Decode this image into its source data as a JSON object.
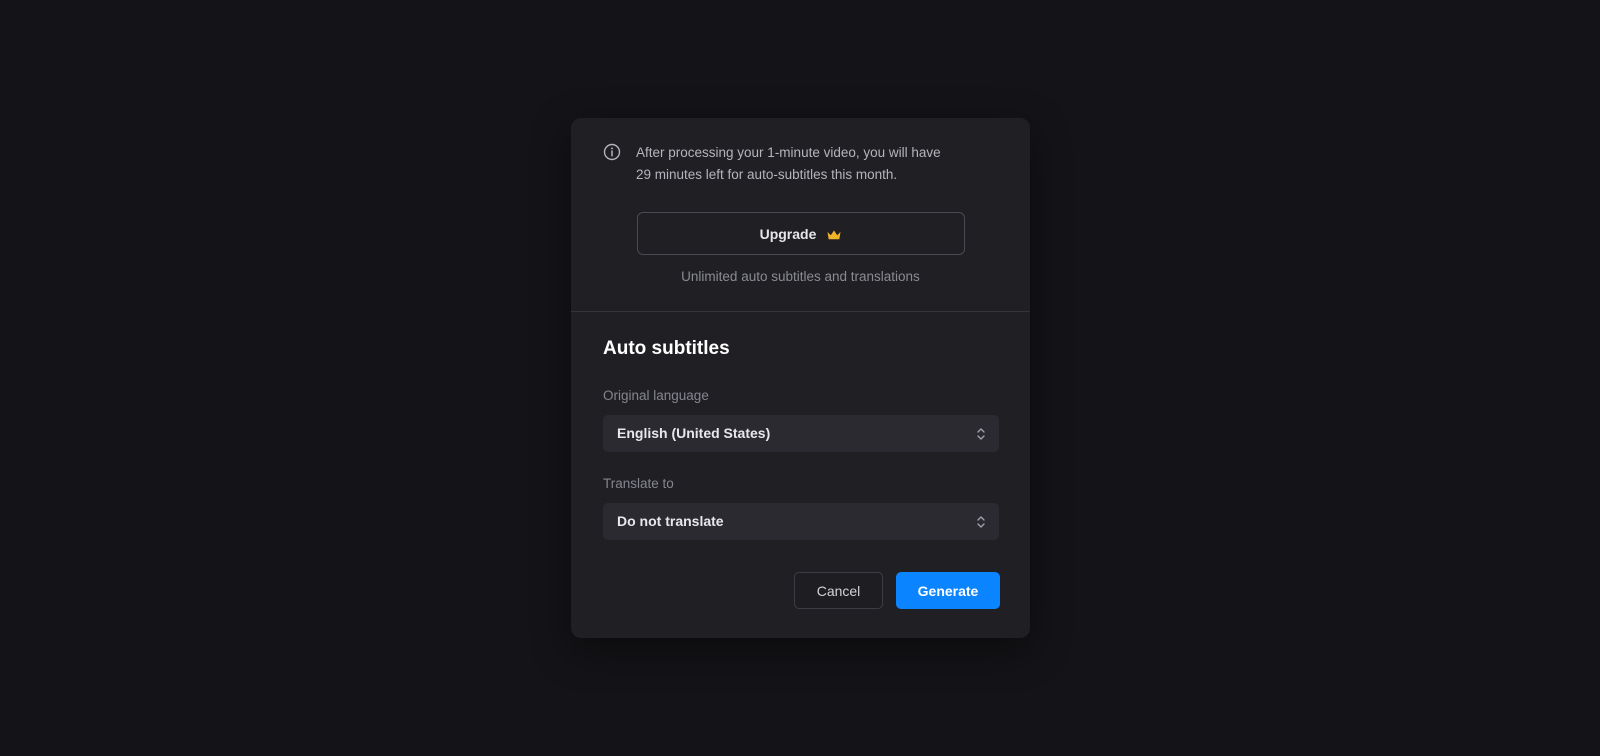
{
  "notice": {
    "icon": "info-icon",
    "line1": "After processing your 1-minute video, you will have",
    "line2": "29 minutes left for auto-subtitles this month.",
    "upgrade_label": "Upgrade",
    "upgrade_icon": "crown-icon",
    "upgrade_subtext": "Unlimited auto subtitles and translations"
  },
  "form": {
    "title": "Auto subtitles",
    "original_language": {
      "label": "Original language",
      "value": "English (United States)"
    },
    "translate_to": {
      "label": "Translate to",
      "value": "Do not translate"
    }
  },
  "actions": {
    "cancel_label": "Cancel",
    "generate_label": "Generate"
  },
  "colors": {
    "background": "#141418",
    "modal": "#202024",
    "accent": "#0a84ff",
    "crown": "#f0b429"
  }
}
